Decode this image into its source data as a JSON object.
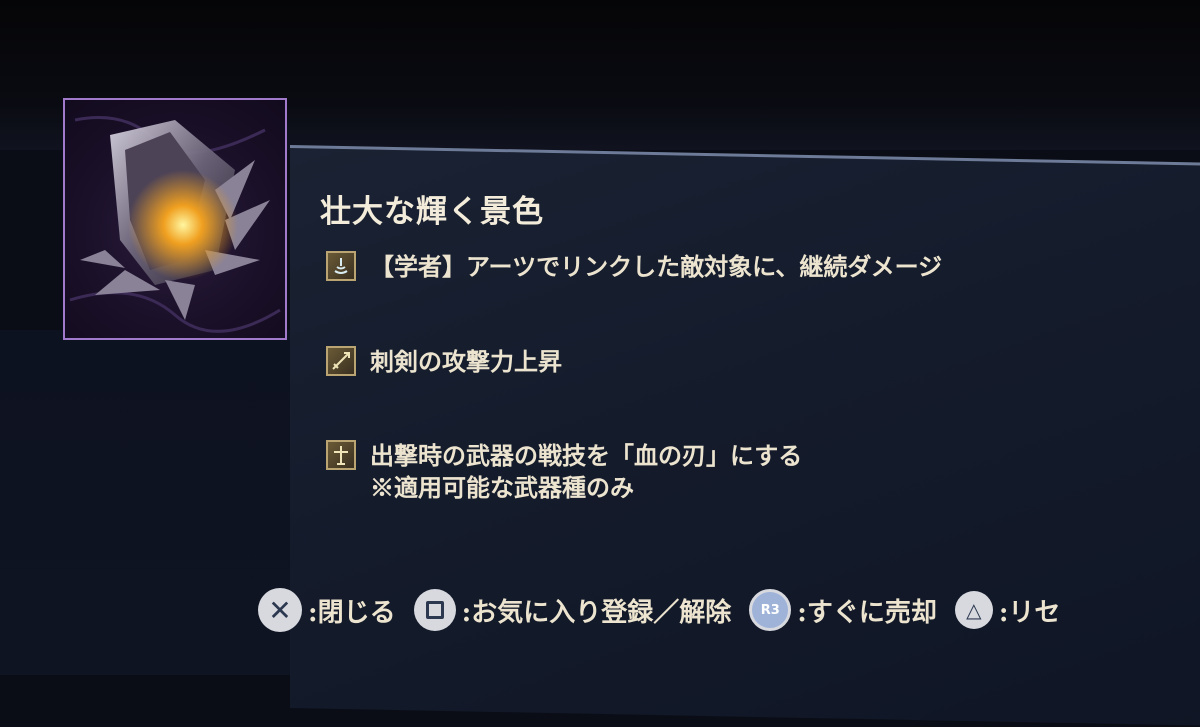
{
  "item": {
    "name": "壮大な輝く景色",
    "image_icon": "crystal-relic-icon"
  },
  "effects": [
    {
      "icon": "scholar-skill-icon",
      "text": "【学者】アーツでリンクした敵対象に、継続ダメージ",
      "note": ""
    },
    {
      "icon": "thrusting-sword-icon",
      "text": "刺剣の攻撃力上昇",
      "note": ""
    },
    {
      "icon": "weapon-skill-icon",
      "text": "出撃時の武器の戦技を「血の刃」にする",
      "note": "※適用可能な武器種のみ"
    }
  ],
  "controls": [
    {
      "button": "cross-button-icon",
      "label": ":閉じる"
    },
    {
      "button": "square-button-icon",
      "label": ":お気に入り登録／解除"
    },
    {
      "button": "r3-button-icon",
      "button_text": "R3",
      "label": ":すぐに売却"
    },
    {
      "button": "triangle-button-icon",
      "label": ":リセ"
    }
  ],
  "colors": {
    "frame_border": "#a27acb",
    "icon_border": "#b9a472",
    "text": "#ece4cf",
    "panel": "#141b2b"
  }
}
